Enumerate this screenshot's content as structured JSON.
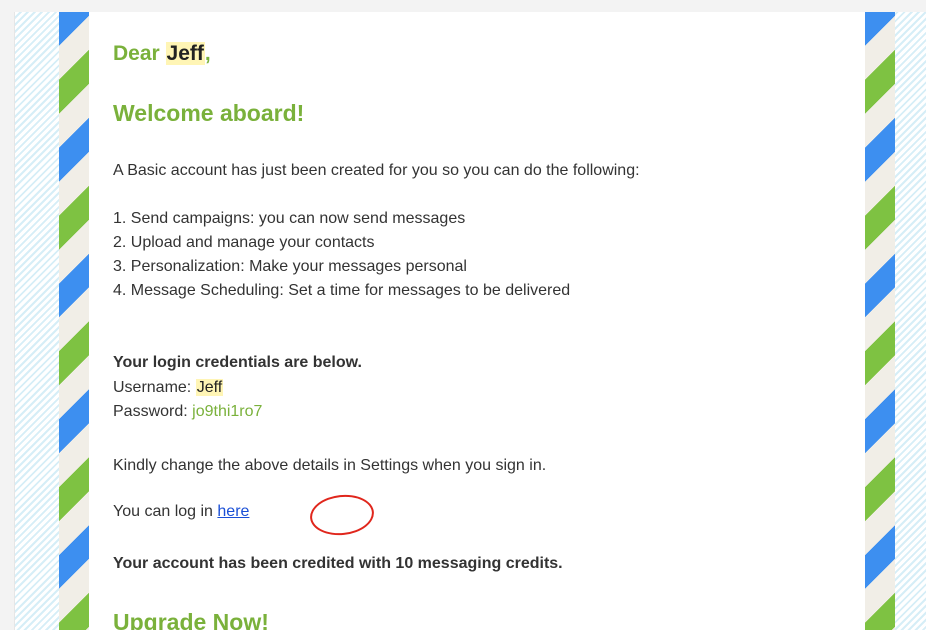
{
  "greeting": {
    "prefix": "Dear",
    "name": "Jeff",
    "suffix": ","
  },
  "welcome_heading": "Welcome aboard!",
  "intro_text": "A Basic account has just been created for you so you can do the following:",
  "features": [
    "1. Send campaigns: you can now send messages",
    "2. Upload and manage your contacts",
    "3. Personalization: Make your messages personal",
    "4. Message Scheduling: Set a time for messages to be delivered"
  ],
  "credentials": {
    "title": "Your login credentials are below.",
    "username_label": "Username:",
    "username": "Jeff",
    "password_label": "Password:",
    "password": "jo9thi1ro7"
  },
  "change_notice": "Kindly change the above details in Settings when you sign in.",
  "login": {
    "prefix": "You can log in",
    "link_text": "here"
  },
  "credits_notice": "Your account has been credited with 10 messaging credits.",
  "upgrade_heading": "Upgrade Now!",
  "colors": {
    "heading_green": "#7ab13b",
    "highlight": "#fff5b5",
    "link_blue": "#1a4fd6",
    "annotation_red": "#e0261c",
    "stripe_blue": "#3d8ff0",
    "stripe_green": "#7ec242"
  }
}
